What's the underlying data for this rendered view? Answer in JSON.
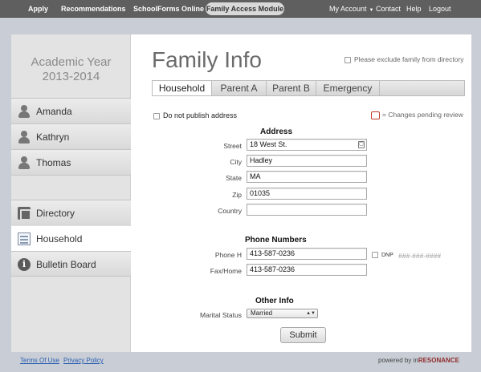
{
  "topnav": {
    "apply": "Apply",
    "recommendations": "Recommendations",
    "schoolforms": "SchoolForms Online",
    "family_access": "Family Access Module",
    "my_account": "My Account",
    "contact": "Contact",
    "help": "Help",
    "logout": "Logout"
  },
  "sidebar": {
    "year_label": "Academic Year",
    "year_value": "2013-2014",
    "students": [
      {
        "label": "Amanda",
        "icon": "person-icon"
      },
      {
        "label": "Kathryn",
        "icon": "person-icon"
      },
      {
        "label": "Thomas",
        "icon": "person-icon"
      }
    ],
    "links": [
      {
        "label": "Directory",
        "icon": "directory-icon"
      },
      {
        "label": "Household",
        "icon": "household-icon",
        "selected": true
      },
      {
        "label": "Bulletin Board",
        "icon": "info-icon"
      }
    ]
  },
  "main": {
    "title": "Family Info",
    "exclude_label": "Please exclude family from directory",
    "tabs": [
      {
        "label": "Household",
        "selected": true
      },
      {
        "label": "Parent A"
      },
      {
        "label": "Parent B"
      },
      {
        "label": "Emergency"
      }
    ],
    "do_not_publish": "Do not publish address",
    "pending_legend": "= Changes pending review",
    "pending_color": "#c0392b",
    "address": {
      "heading": "Address",
      "street_label": "Street",
      "street_value": "18 West St.",
      "city_label": "City",
      "city_value": "Hadley",
      "state_label": "State",
      "state_value": "MA",
      "zip_label": "Zip",
      "zip_value": "01035",
      "country_label": "Country",
      "country_value": ""
    },
    "phones": {
      "heading": "Phone Numbers",
      "home_label": "Phone H",
      "home_value": "413-587-0236",
      "dnp_label": "DNP",
      "placeholder": "###-###-####",
      "fax_label": "Fax/Home",
      "fax_value": "413-587-0236"
    },
    "other": {
      "heading": "Other Info",
      "marital_label": "Marital Status",
      "marital_value": "Married"
    },
    "submit": "Submit"
  },
  "footer": {
    "terms": "Terms Of Use",
    "privacy": "Privacy Policy",
    "powered_prefix": "powered by in",
    "powered_brand": "RESONANCE"
  }
}
